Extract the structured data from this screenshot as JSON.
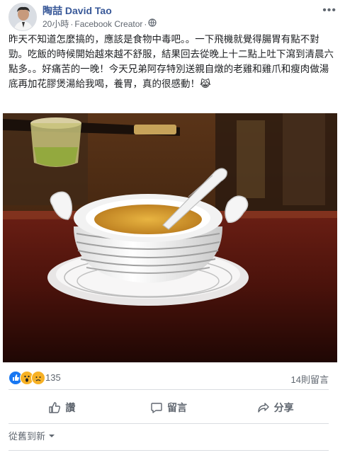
{
  "post": {
    "author": "陶喆 David Tao",
    "time": "20小時",
    "separator": "·",
    "role": "Facebook Creator",
    "privacy_icon": "globe-icon",
    "more_icon": "more-icon",
    "text": "昨天不知道怎麼搞的，應該是食物中毒吧。。一下飛機就覺得腸胃有點不對勁。吃飯的時候開始越來越不舒服，結果回去從晚上十二點上吐下瀉到清晨六點多。。好痛苦的一晚！今天兄弟阿存特別送親自燉的老雞和雞爪和瘦肉做湯底再加花膠煲湯給我喝，養胃，真的很感動！😹"
  },
  "photo": {
    "subject": "soup-tureen-photo"
  },
  "reactions": {
    "icons": [
      "like-icon",
      "wow-icon",
      "sad-icon"
    ],
    "colors": {
      "like": "#1877f2",
      "wow": "#f7b125",
      "sad": "#f7b125"
    },
    "count": "135",
    "comments": "14則留言"
  },
  "actions": {
    "like": "讚",
    "comment": "留言",
    "share": "分享"
  },
  "comments_sort": {
    "label": "從舊到新",
    "icon": "caret-down-icon"
  },
  "colors": {
    "author": "#385898",
    "muted": "#606770",
    "accent": "#1877f2"
  }
}
